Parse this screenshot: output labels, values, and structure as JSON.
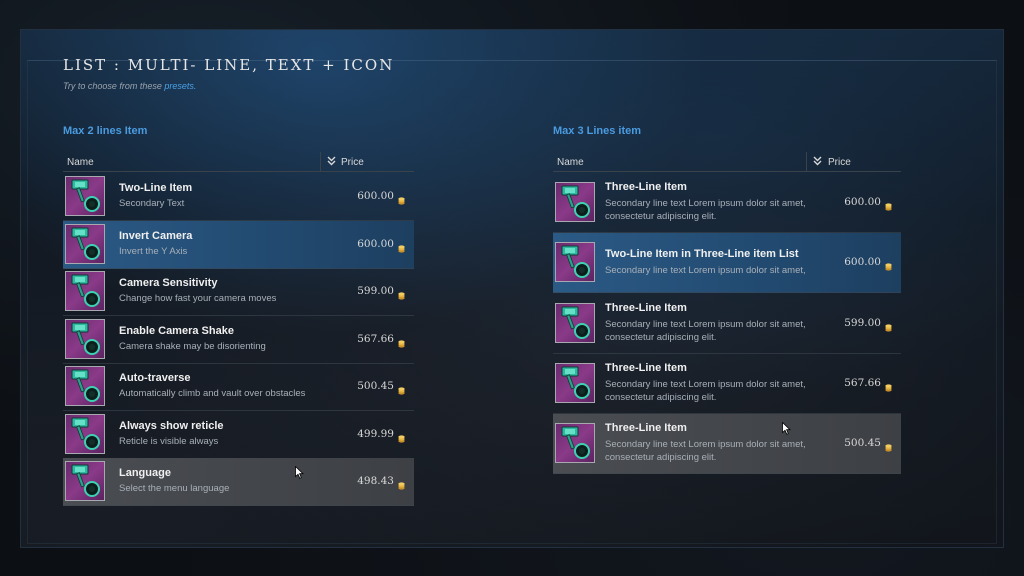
{
  "page": {
    "title": "LIST : MULTI- LINE, TEXT + ICON",
    "subtitle_prefix": "Try to choose from these ",
    "subtitle_link": "presets.",
    "subtitle_suffix": ""
  },
  "colors": {
    "accent": "#4a9be0",
    "selected_row": "#2b5a86",
    "hover_row": "#4a4d52",
    "thumb": "#8a3a88",
    "coin": "#e3b341"
  },
  "left_list": {
    "section_title": "Max 2 lines Item",
    "header": {
      "name": "Name",
      "price": "Price",
      "sort_icon": "double-chevron-down-icon"
    },
    "items": [
      {
        "title": "Two-Line Item",
        "subtitle": "Secondary Text",
        "price": "600.00",
        "state": "normal",
        "icon": "hammer-icon"
      },
      {
        "title": "Invert Camera",
        "subtitle": "Invert the Y Axis",
        "price": "600.00",
        "state": "selected",
        "icon": "hammer-icon"
      },
      {
        "title": "Camera Sensitivity",
        "subtitle": "Change how fast your camera moves",
        "price": "599.00",
        "state": "normal",
        "icon": "hammer-icon"
      },
      {
        "title": "Enable Camera Shake",
        "subtitle": "Camera shake may be disorienting",
        "price": "567.66",
        "state": "normal",
        "icon": "hammer-icon"
      },
      {
        "title": "Auto-traverse",
        "subtitle": "Automatically climb and vault over obstacles",
        "price": "500.45",
        "state": "normal",
        "icon": "hammer-icon"
      },
      {
        "title": "Always show reticle",
        "subtitle": "Reticle is visible always",
        "price": "499.99",
        "state": "normal",
        "icon": "hammer-icon"
      },
      {
        "title": "Language",
        "subtitle": "Select the menu language",
        "price": "498.43",
        "state": "hover",
        "icon": "hammer-icon"
      }
    ]
  },
  "right_list": {
    "section_title": "Max 3 Lines item",
    "header": {
      "name": "Name",
      "price": "Price",
      "sort_icon": "double-chevron-down-icon"
    },
    "items": [
      {
        "title": "Three-Line Item",
        "line1": "Secondary line text Lorem ipsum dolor sit amet,",
        "line2": "consectetur adipiscing elit.",
        "price": "600.00",
        "state": "normal",
        "icon": "hammer-icon"
      },
      {
        "title": "Two-Line Item in Three-Line item List",
        "line1": "Secondary line text Lorem ipsum dolor sit amet,",
        "line2": "",
        "price": "600.00",
        "state": "selected",
        "icon": "hammer-icon"
      },
      {
        "title": "Three-Line Item",
        "line1": "Secondary line text Lorem ipsum dolor sit amet,",
        "line2": "consectetur adipiscing elit.",
        "price": "599.00",
        "state": "normal",
        "icon": "hammer-icon"
      },
      {
        "title": "Three-Line Item",
        "line1": "Secondary line text Lorem ipsum dolor sit amet,",
        "line2": "consectetur adipiscing elit.",
        "price": "567.66",
        "state": "normal",
        "icon": "hammer-icon"
      },
      {
        "title": "Three-Line Item",
        "line1": "Secondary line text Lorem ipsum dolor sit amet,",
        "line2": "consectetur adipiscing elit.",
        "price": "500.45",
        "state": "hover",
        "icon": "hammer-icon"
      }
    ]
  }
}
